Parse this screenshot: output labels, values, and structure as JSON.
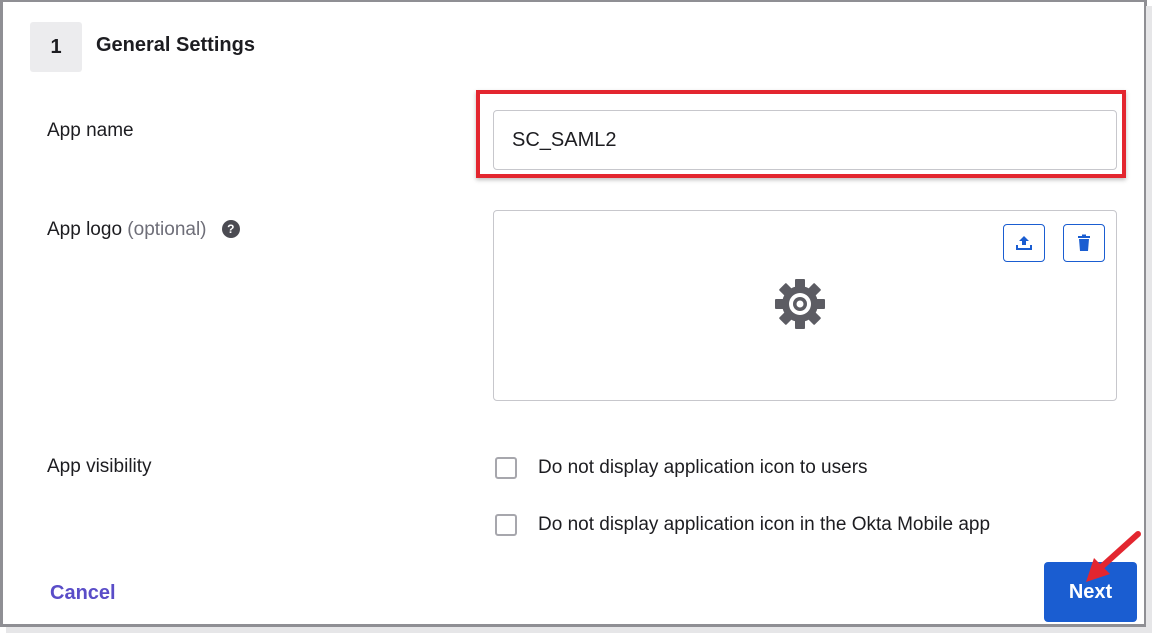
{
  "section": {
    "step_number": "1",
    "title": "General Settings"
  },
  "app_name": {
    "label": "App name",
    "value": "SC_SAML2"
  },
  "app_logo": {
    "label": "App logo",
    "optional_text": "(optional)",
    "help_glyph": "?",
    "upload_icon": "upload-icon",
    "delete_icon": "trash-icon",
    "placeholder_icon": "gear-icon"
  },
  "app_visibility": {
    "label": "App visibility",
    "options": [
      {
        "label": "Do not display application icon to users",
        "checked": false
      },
      {
        "label": "Do not display application icon in the Okta Mobile app",
        "checked": false
      }
    ]
  },
  "footer": {
    "cancel_label": "Cancel",
    "next_label": "Next"
  },
  "colors": {
    "primary": "#1a5dd1",
    "link": "#5a4dc8",
    "highlight": "#e3262f"
  }
}
